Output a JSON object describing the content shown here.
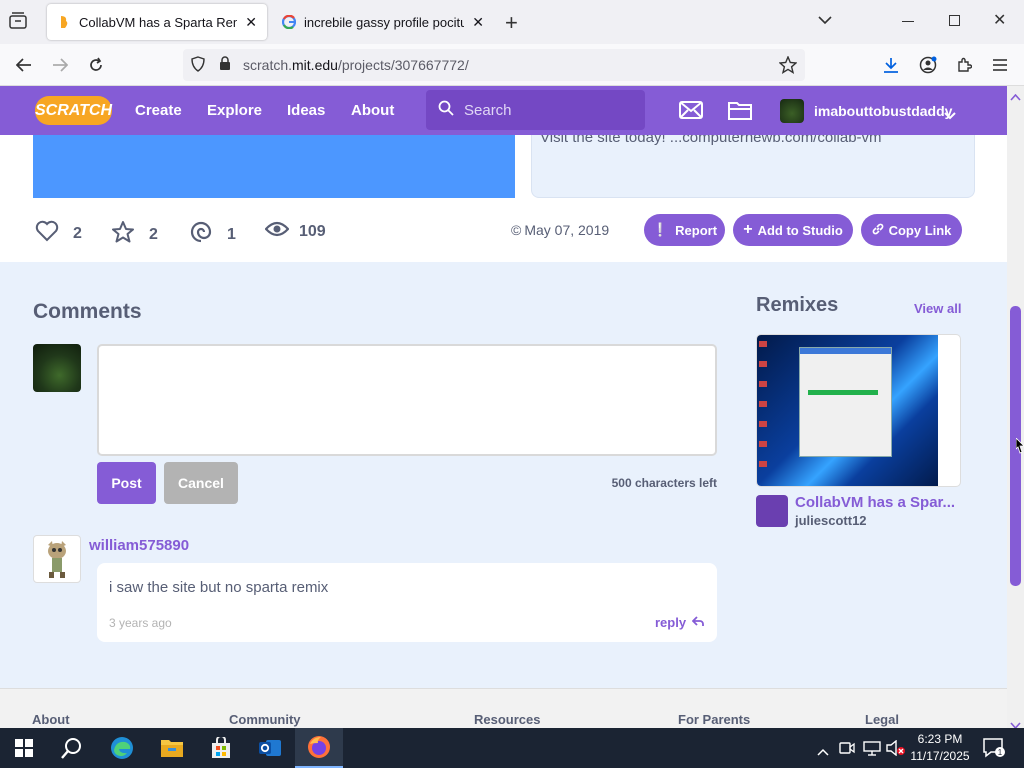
{
  "browser": {
    "tabs": [
      {
        "title": "CollabVM has a Sparta Remix (V",
        "active": true
      },
      {
        "title": "increbile gassy profile pociture",
        "active": false
      }
    ],
    "url_prefix": "scratch.",
    "url_domain": "mit.edu",
    "url_path": "/projects/307667772/"
  },
  "header": {
    "logo": "SCRATCH",
    "links": [
      "Create",
      "Explore",
      "Ideas",
      "About"
    ],
    "search_placeholder": "Search",
    "username": "imabouttobustdaddy"
  },
  "project": {
    "notes_text": "Visit the site today! ...computernewb.com/collab-vm",
    "stats": {
      "loves": "2",
      "favorites": "2",
      "remixes": "1",
      "views": "109"
    },
    "date": "May 07, 2019",
    "buttons": {
      "report": "Report",
      "add_to_studio": "Add to Studio",
      "copy_link": "Copy Link"
    }
  },
  "comments": {
    "title": "Comments",
    "post_label": "Post",
    "cancel_label": "Cancel",
    "chars_left": "500 characters left",
    "items": [
      {
        "username": "william575890",
        "text": "i saw the site but no sparta remix",
        "time": "3 years ago",
        "reply": "reply"
      }
    ]
  },
  "remixes": {
    "title": "Remixes",
    "view_all": "View all",
    "items": [
      {
        "title": "CollabVM has a Spar...",
        "author": "juliescott12"
      }
    ]
  },
  "footer": {
    "columns": [
      "About",
      "Community",
      "Resources",
      "For Parents",
      "Legal"
    ]
  },
  "taskbar": {
    "time": "6:23 PM",
    "date": "11/17/2025"
  },
  "colors": {
    "scratch_purple": "#855cd6",
    "link_purple": "#855cd6",
    "text_gray": "#575e75",
    "page_bg": "#e9f1fc"
  }
}
